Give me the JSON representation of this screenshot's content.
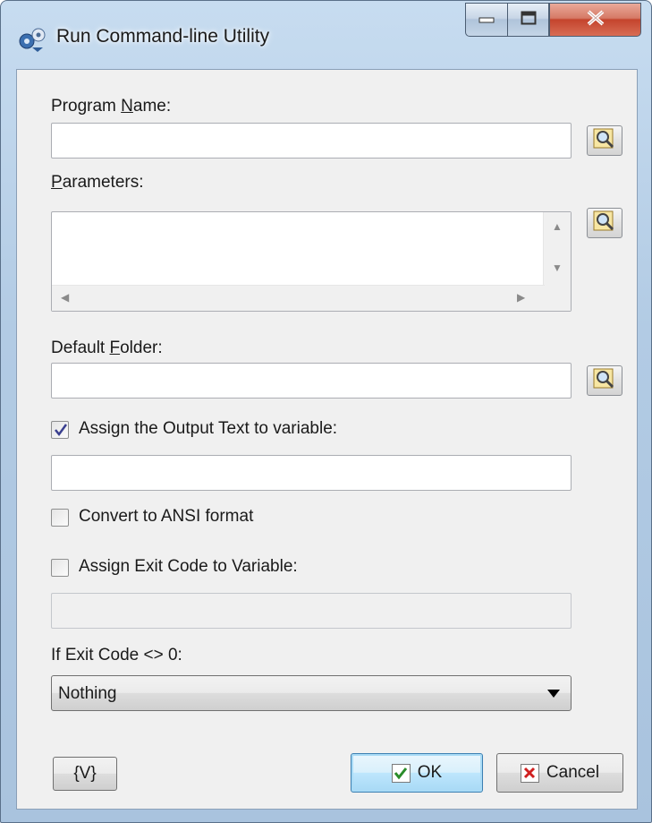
{
  "window": {
    "title": "Run Command-line Utility",
    "controls": {
      "minimize": "minimize",
      "maximize": "maximize",
      "close": "close"
    }
  },
  "program_name": {
    "label_pre": "Program ",
    "label_acc": "N",
    "label_post": "ame:",
    "value": ""
  },
  "parameters": {
    "label_acc": "P",
    "label_post": "arameters:",
    "value": ""
  },
  "default_folder": {
    "label_pre": "Default ",
    "label_acc": "F",
    "label_post": "older:",
    "value": ""
  },
  "assign_output": {
    "label": "Assign the Output Text to variable:",
    "checked": true,
    "value": ""
  },
  "convert_ansi": {
    "label": "Convert to ANSI format",
    "checked": false
  },
  "assign_exit_code": {
    "label": "Assign Exit Code to Variable:",
    "checked": false,
    "value": ""
  },
  "if_exit_code": {
    "label": "If Exit Code <> 0:",
    "selected": "Nothing"
  },
  "buttons": {
    "variables": "{V}",
    "ok": "OK",
    "cancel": "Cancel"
  },
  "colors": {
    "ok_check": "#2a8c2a",
    "cancel_x": "#d02020",
    "title_bar": "#b9d1ea",
    "close_button": "#c4442d"
  }
}
